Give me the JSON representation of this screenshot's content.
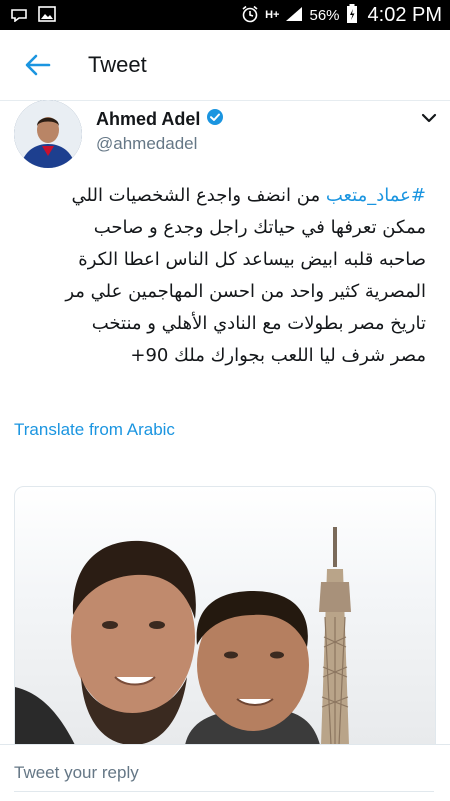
{
  "status_bar": {
    "signal_label": "H+",
    "battery": "56%",
    "time": "4:02 PM"
  },
  "app_bar": {
    "title": "Tweet",
    "back_icon": "arrow-left-icon"
  },
  "tweet": {
    "author_name": "Ahmed Adel",
    "author_handle": "@ahmedadel",
    "verified": true,
    "hashtag": "#عماد_متعب",
    "lines": [
      "من انضف واجدع الشخصيات اللي",
      "ممكن تعرفها في حياتك راجل وجدع و صاحب",
      "صاحبه قلبه ابيض بيساعد كل الناس اعطا الكرة",
      "المصرية كثير واحد من احسن المهاجمين علي مر",
      "تاريخ مصر بطولات مع النادي الأهلي و منتخب",
      "مصر شرف ليا اللعب بجوارك ملك 90+"
    ],
    "translate_label": "Translate from Arabic"
  },
  "reply": {
    "placeholder": "Tweet your reply"
  },
  "colors": {
    "accent": "#1b95e0",
    "text_primary": "#14171a",
    "text_secondary": "#657786"
  }
}
